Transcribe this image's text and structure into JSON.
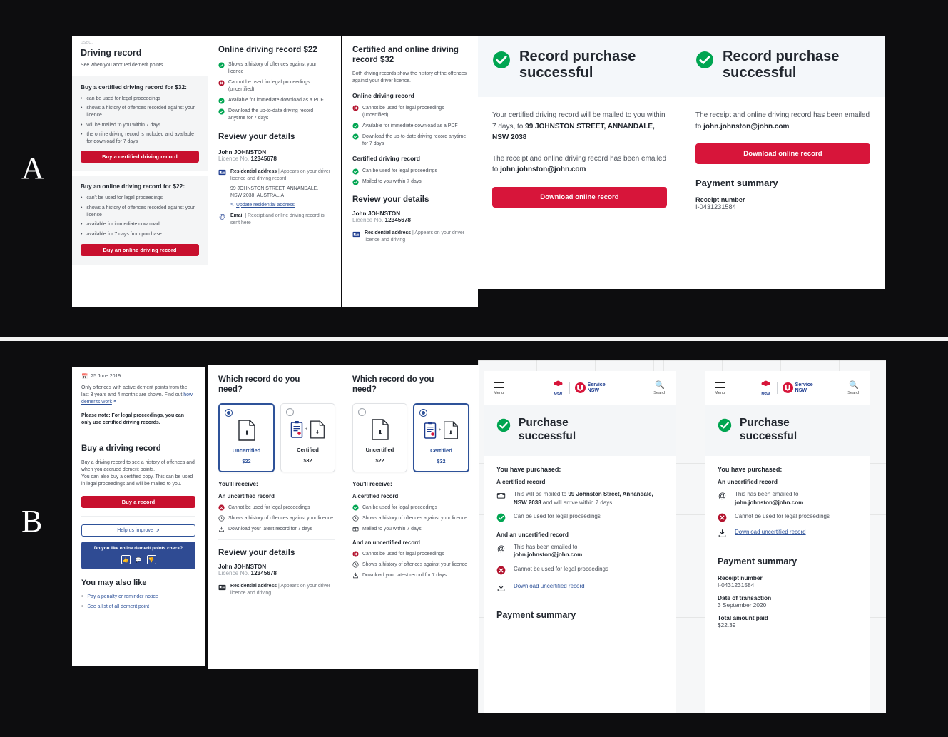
{
  "figure": {
    "label_a": "A",
    "label_b": "B"
  },
  "section_a": {
    "panel1": {
      "cutoff_text": "used.",
      "title": "Driving record",
      "subtitle": "See when you accrued demerit points.",
      "certified": {
        "heading": "Buy a certified driving record for $32:",
        "bullets": [
          "can be used for legal proceedings",
          "shows a history of offences recorded against your licence",
          "will be mailed to you within 7 days",
          "the online driving record is included and available for download for 7 days"
        ],
        "cta": "Buy a certified driving record"
      },
      "online": {
        "heading": "Buy an online driving record for $22:",
        "bullets": [
          "can't be used for legal proceedings",
          "shows a history of offences recorded against your licence",
          "available for immediate download",
          "available for 7 days from purchase"
        ],
        "cta": "Buy an online driving record"
      }
    },
    "panel2": {
      "title": "Online driving record $22",
      "features": [
        {
          "icon": "check-circle-green",
          "text": "Shows a history of offences against your licence"
        },
        {
          "icon": "cross-circle-red",
          "text": "Cannot be used for legal proceedings (uncertified)"
        },
        {
          "icon": "check-circle-green",
          "text": "Available for immediate download as a PDF"
        },
        {
          "icon": "check-circle-green",
          "text": "Download the up-to-date driving record anytime for 7 days"
        }
      ],
      "review_title": "Review your details",
      "name": "John JOHNSTON",
      "licence_label": "Licence No.",
      "licence_no": "12345678",
      "address_label": "Residential address",
      "address_hint": "| Appears on your driver licence and driving record",
      "address": "99 JOHNSTON STREET, ANNANDALE, NSW 2038, AUSTRALIA",
      "update_link": "Update residential address",
      "email_label": "Email",
      "email_hint": "| Receipt and online driving record is sent here"
    },
    "panel3": {
      "title": "Certified and online driving record $32",
      "intro": "Both driving records show the history of the offences against your driver licence.",
      "online_heading": "Online driving record",
      "online_features": [
        {
          "icon": "cross-circle-red",
          "text": "Cannot be used for legal proceedings (uncertified)"
        },
        {
          "icon": "check-circle-green",
          "text": "Available for immediate download as a PDF"
        },
        {
          "icon": "check-circle-green",
          "text": "Download the up-to-date driving record anytime for 7 days"
        }
      ],
      "certified_heading": "Certified driving record",
      "certified_features": [
        {
          "icon": "check-circle-green",
          "text": "Can be used for legal proceedings"
        },
        {
          "icon": "check-circle-green",
          "text": "Mailed to you within 7 days"
        }
      ],
      "review_title": "Review your details",
      "name": "John JOHNSTON",
      "licence_label": "Licence No.",
      "licence_no": "12345678",
      "address_label": "Residential address",
      "address_hint": "| Appears on your driver licence and driving"
    },
    "panel4": {
      "title": "Record purchase successful",
      "para1_a": "Your certified driving record will be mailed to you within 7 days, to ",
      "address": "99 JOHNSTON STREET, ANNANDALE, NSW 2038",
      "para2_a": "The receipt and online driving record has been emailed to ",
      "email": "john.johnston@john.com",
      "cta": "Download online record"
    },
    "panel5": {
      "title": "Record purchase successful",
      "para1_a": "The receipt and online driving record has been emailed to ",
      "email": "john.johnston@john.com",
      "cta": "Download online record",
      "payment_title": "Payment summary",
      "receipt_label": "Receipt number",
      "receipt_value": "I-0431231584"
    }
  },
  "section_b": {
    "panel1": {
      "date": "25 June 2019",
      "note": "Only offences with active demerit points from the last 3 years and 4 months are shown. Find out ",
      "note_link": "how demerits work",
      "warning": "Please note: For legal proceedings, you can only use certified driving records.",
      "buy_title": "Buy a driving record",
      "buy_para1": "Buy a driving record to see a history of offences and when you accrued demerit points.",
      "buy_para2": "You can also buy a certified copy. This can be used in legal proceedings and will be mailed to you.",
      "cta": "Buy a record",
      "improve_cta": "Help us improve",
      "survey_question": "Do you like online demerit points check?",
      "survey_options": [
        "thumbs-up",
        "neutral",
        "thumbs-down"
      ],
      "also_like_title": "You may also like",
      "also_like_links": [
        "Pay a penalty or reminder notice",
        "See a list of all demerit point"
      ]
    },
    "panel2": {
      "title": "Which record do you need?",
      "options": [
        {
          "name": "Uncertified",
          "price": "$22",
          "selected": true,
          "art": "pdf"
        },
        {
          "name": "Certified",
          "price": "$32",
          "selected": false,
          "art": "cert-plus-pdf"
        }
      ],
      "receive_title": "You'll receive:",
      "groups": [
        {
          "heading": "An uncertified record",
          "items": [
            {
              "icon": "cross-circle-red",
              "text": "Cannot be used for legal proceedings"
            },
            {
              "icon": "clock",
              "text": "Shows a history of offences against your licence"
            },
            {
              "icon": "download",
              "text": "Download your latest record for 7 days"
            }
          ]
        }
      ],
      "review_title": "Review your details",
      "name": "John JOHNSTON",
      "licence_label": "Licence No.",
      "licence_no": "12345678",
      "address_label": "Residential address",
      "address_hint": "| Appears on your driver licence and driving"
    },
    "panel3": {
      "title": "Which record do you need?",
      "options": [
        {
          "name": "Uncertified",
          "price": "$22",
          "selected": false,
          "art": "pdf"
        },
        {
          "name": "Certified",
          "price": "$32",
          "selected": true,
          "art": "cert-plus-pdf"
        }
      ],
      "receive_title": "You'll receive:",
      "groups": [
        {
          "heading": "A certified record",
          "items": [
            {
              "icon": "check-circle-green",
              "text": "Can be used for legal proceedings"
            },
            {
              "icon": "clock",
              "text": "Shows a history of offences against your licence"
            },
            {
              "icon": "mailbox",
              "text": "Mailed to you within 7 days"
            }
          ]
        },
        {
          "heading": "And an uncertified record",
          "items": [
            {
              "icon": "cross-circle-red",
              "text": "Cannot be used for legal proceedings"
            },
            {
              "icon": "clock",
              "text": "Shows a history of offences against your licence"
            },
            {
              "icon": "download",
              "text": "Download your latest record for 7 days"
            }
          ]
        }
      ]
    },
    "panel4": {
      "header": {
        "menu_label": "Menu",
        "search_label": "Search",
        "brand_nsw": "NSW",
        "brand_service": "Service",
        "brand_service2": "NSW"
      },
      "title": "Purchase successful",
      "purchased_title": "You have purchased:",
      "group1_heading": "A certified record",
      "mail_text_a": "This will be mailed to ",
      "mail_address": "99 Johnston Street, Annandale, NSW 2038",
      "mail_text_b": " and will arrive within 7 days.",
      "legal_ok": "Can be used for legal proceedings",
      "group2_heading": "And an uncertified record",
      "email_text": "This has been emailed to ",
      "email": "john.johnston@john.com",
      "legal_no": "Cannot be used for legal proceedings",
      "download_link": "Download uncertified record",
      "payment_title": "Payment summary"
    },
    "panel5": {
      "header": {
        "menu_label": "Menu",
        "search_label": "Search",
        "brand_nsw": "NSW",
        "brand_service": "Service",
        "brand_service2": "NSW"
      },
      "title": "Purchase successful",
      "purchased_title": "You have purchased:",
      "group_heading": "An uncertified record",
      "email_text": "This has been emailed to ",
      "email": "john.johnston@john.com",
      "legal_no": "Cannot be used for legal proceedings",
      "download_link": "Download uncertified record",
      "payment_title": "Payment summary",
      "receipt_label": "Receipt number",
      "receipt_value": "I-0431231584",
      "date_label": "Date of transaction",
      "date_value": "3 September 2020",
      "total_label": "Total amount paid",
      "total_value": "$22.39"
    }
  },
  "colors": {
    "brand_red": "#d7153a",
    "cta_red": "#c8102e",
    "brand_navy": "#2e5299",
    "success_green": "#00a551",
    "error_red": "#b3122d",
    "success_band": "#f4f7fa"
  }
}
